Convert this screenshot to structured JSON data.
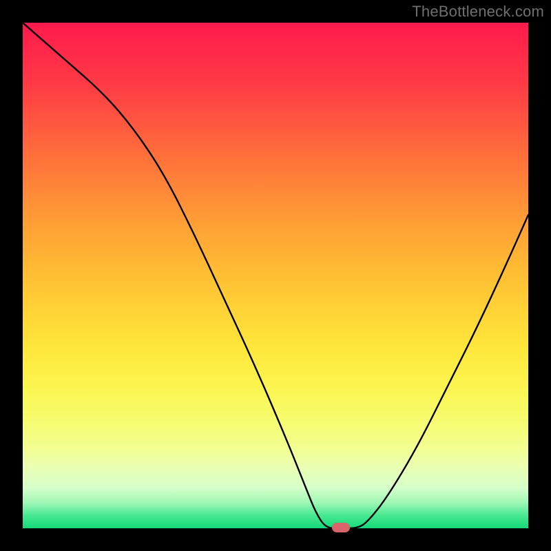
{
  "watermark": "TheBottleneck.com",
  "chart_data": {
    "type": "line",
    "title": "",
    "xlabel": "",
    "ylabel": "",
    "xlim": [
      0,
      100
    ],
    "ylim": [
      0,
      100
    ],
    "series": [
      {
        "name": "curve",
        "x": [
          0,
          8,
          16,
          22,
          28,
          34,
          40,
          46,
          52,
          56,
          58,
          60,
          63,
          66,
          68,
          72,
          78,
          84,
          90,
          96,
          100
        ],
        "values": [
          100,
          93,
          86,
          79,
          70,
          58,
          45,
          32,
          18,
          8,
          3,
          0,
          0,
          0,
          1,
          6,
          16,
          28,
          40,
          53,
          62
        ]
      }
    ],
    "marker": {
      "x": 63,
      "y": 0,
      "color": "#d9636a",
      "shape": "pill"
    },
    "background_gradient": {
      "top": "#ff1a4d",
      "middle": "#ffe63a",
      "bottom": "#14d97a"
    },
    "grid": false,
    "legend": false
  }
}
